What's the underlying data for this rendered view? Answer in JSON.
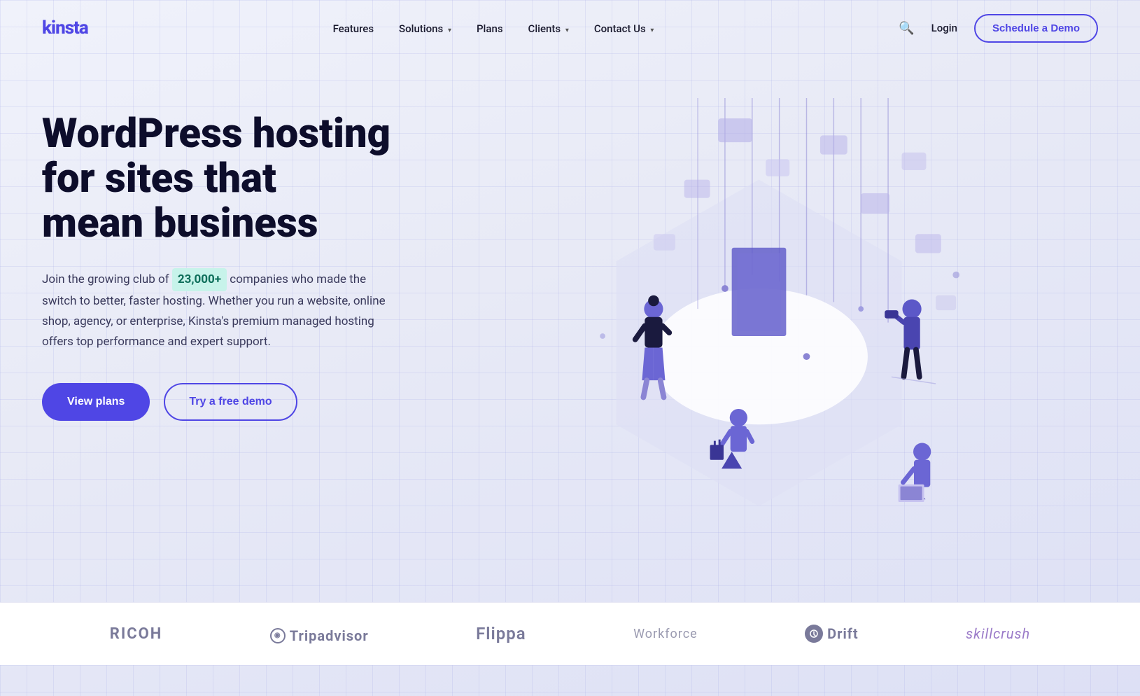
{
  "brand": {
    "name": "kinsta",
    "color": "#4f46e5"
  },
  "nav": {
    "links": [
      {
        "label": "Features",
        "hasDropdown": false
      },
      {
        "label": "Solutions",
        "hasDropdown": true
      },
      {
        "label": "Plans",
        "hasDropdown": false
      },
      {
        "label": "Clients",
        "hasDropdown": true
      },
      {
        "label": "Contact Us",
        "hasDropdown": true
      }
    ],
    "login_label": "Login",
    "schedule_label": "Schedule a Demo",
    "search_placeholder": "Search"
  },
  "hero": {
    "title_line1": "WordPress hosting",
    "title_line2": "for sites that",
    "title_line3": "mean business",
    "description_pre": "Join the growing club of",
    "highlight": "23,000+",
    "description_post": "companies who made the switch to better, faster hosting. Whether you run a website, online shop, agency, or enterprise, Kinsta's premium managed hosting offers top performance and expert support.",
    "btn_primary": "View plans",
    "btn_secondary": "Try a free demo"
  },
  "logos": [
    {
      "name": "RICOH",
      "class": "ricoh"
    },
    {
      "name": "Tripadvisor",
      "class": "tripadvisor"
    },
    {
      "name": "Flippa",
      "class": "flippa"
    },
    {
      "name": "Workforce",
      "class": "workforce"
    },
    {
      "name": "Drift",
      "class": "drift"
    },
    {
      "name": "skillcrush",
      "class": "skillcrush"
    }
  ]
}
